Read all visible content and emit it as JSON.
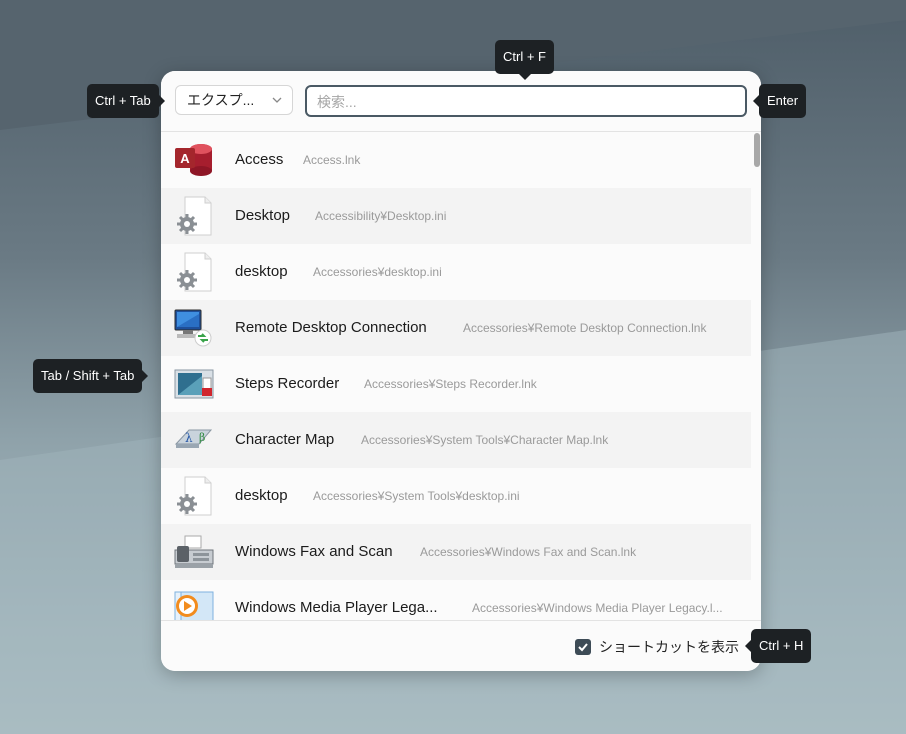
{
  "background_color": "#6a7a84",
  "accent_color": "#3d4b56",
  "dropdown": {
    "label": "エクスプ...",
    "icon": "chevron-down-icon"
  },
  "search": {
    "placeholder": "検索..."
  },
  "items": [
    {
      "name": "Access",
      "path": "Access.lnk",
      "icon": "access-icon"
    },
    {
      "name": "Desktop",
      "path": "Accessibility¥Desktop.ini",
      "icon": "settings-file-icon"
    },
    {
      "name": "desktop",
      "path": "Accessories¥desktop.ini",
      "icon": "settings-file-icon"
    },
    {
      "name": "Remote Desktop Connection",
      "path": "Accessories¥Remote Desktop Connection.lnk",
      "icon": "remote-desktop-icon"
    },
    {
      "name": "Steps Recorder",
      "path": "Accessories¥Steps Recorder.lnk",
      "icon": "steps-recorder-icon"
    },
    {
      "name": "Character Map",
      "path": "Accessories¥System Tools¥Character Map.lnk",
      "icon": "character-map-icon"
    },
    {
      "name": "desktop",
      "path": "Accessories¥System Tools¥desktop.ini",
      "icon": "settings-file-icon"
    },
    {
      "name": "Windows Fax and Scan",
      "path": "Accessories¥Windows Fax and Scan.lnk",
      "icon": "fax-scanner-icon"
    },
    {
      "name": "Windows Media Player Lega...",
      "path": "Accessories¥Windows Media Player Legacy.l...",
      "icon": "media-player-icon"
    }
  ],
  "footer": {
    "checkbox_label": "ショートカットを表示",
    "checked": true
  },
  "hints": {
    "dropdown": "Ctrl + Tab",
    "search": "Ctrl + F",
    "enter": "Enter",
    "list": "Tab / Shift + Tab",
    "checkbox": "Ctrl + H"
  }
}
